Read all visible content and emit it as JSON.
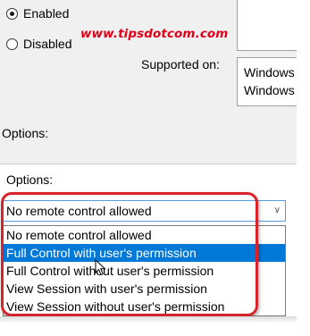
{
  "policy_state": {
    "options": [
      {
        "label": "Enabled",
        "checked": true
      },
      {
        "label": "Disabled",
        "checked": false
      }
    ]
  },
  "watermark": "www.tipsdotcom.com",
  "supported_on": {
    "label": "Supported on:",
    "lines": [
      "Windows",
      "Windows"
    ]
  },
  "options_section_label": "Options:",
  "options_panel": {
    "label": "Options:",
    "combo": {
      "selected_value": "No remote control allowed",
      "arrow_icon": "chevron-down-icon"
    },
    "dropdown_items": [
      {
        "label": "No remote control allowed",
        "selected": false
      },
      {
        "label": "Full Control with user's permission",
        "selected": true
      },
      {
        "label": "Full Control without user's permission",
        "selected": false
      },
      {
        "label": "View Session with user's permission",
        "selected": false
      },
      {
        "label": "View Session without user's permission",
        "selected": false
      }
    ]
  },
  "colors": {
    "selection": "#0078d7",
    "highlight_border": "#d9232b",
    "watermark": "#e0001a",
    "panel_background": "#f0f0f0"
  }
}
